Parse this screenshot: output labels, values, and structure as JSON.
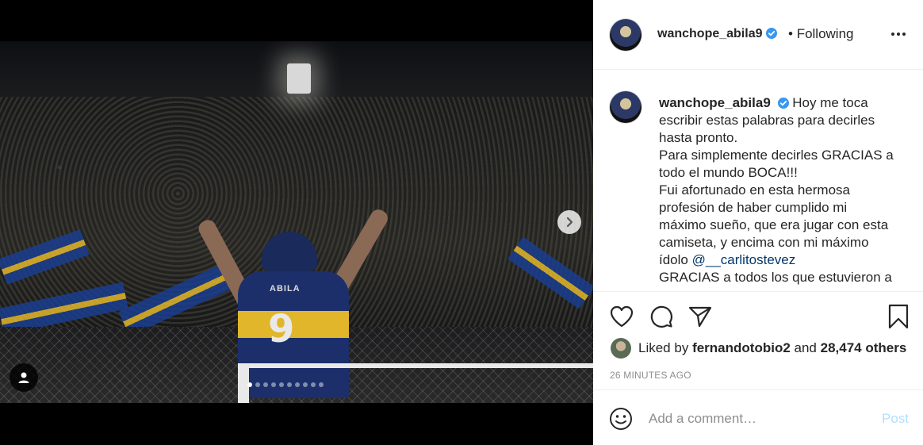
{
  "post": {
    "username": "wanchope_abila9",
    "separator": "•",
    "follow_status": "Following",
    "caption_lines": [
      "Hoy me toca",
      "escribir estas palabras para decirles",
      "hasta pronto.",
      "Para simplemente decirles GRACIAS a",
      "todo el mundo BOCA!!!",
      "Fui afortunado en esta hermosa",
      "profesión de haber cumplido mi",
      "máximo sueño, que era jugar con esta",
      "camiseta, y encima con mi máximo",
      "ídolo",
      "GRACIAS a todos los que estuvieron a"
    ],
    "mention": "@__carlitostevez",
    "liked_by_prefix": "Liked by",
    "liked_by_user": "fernandotobio2",
    "liked_by_and": "and",
    "likes_others": "28,474 others",
    "time_ago": "26 MINUTES AGO",
    "comment_placeholder": "Add a comment…",
    "post_label": "Post"
  },
  "media": {
    "jersey_name": "ABILA",
    "jersey_number": "9",
    "carousel_count": 10,
    "carousel_active": 1
  },
  "icons": {
    "verified": "verified-badge-icon",
    "more": "more-options-icon",
    "like": "heart-icon",
    "comment": "comment-icon",
    "share": "share-icon",
    "save": "bookmark-icon",
    "emoji": "emoji-icon",
    "next": "chevron-right-icon",
    "tags": "user-tag-icon"
  },
  "colors": {
    "verified_blue": "#3897f0",
    "post_disabled": "#b2dffc",
    "muted_text": "#8e8e8e",
    "boca_blue": "#1c2f6b",
    "boca_gold": "#e1b62a"
  }
}
